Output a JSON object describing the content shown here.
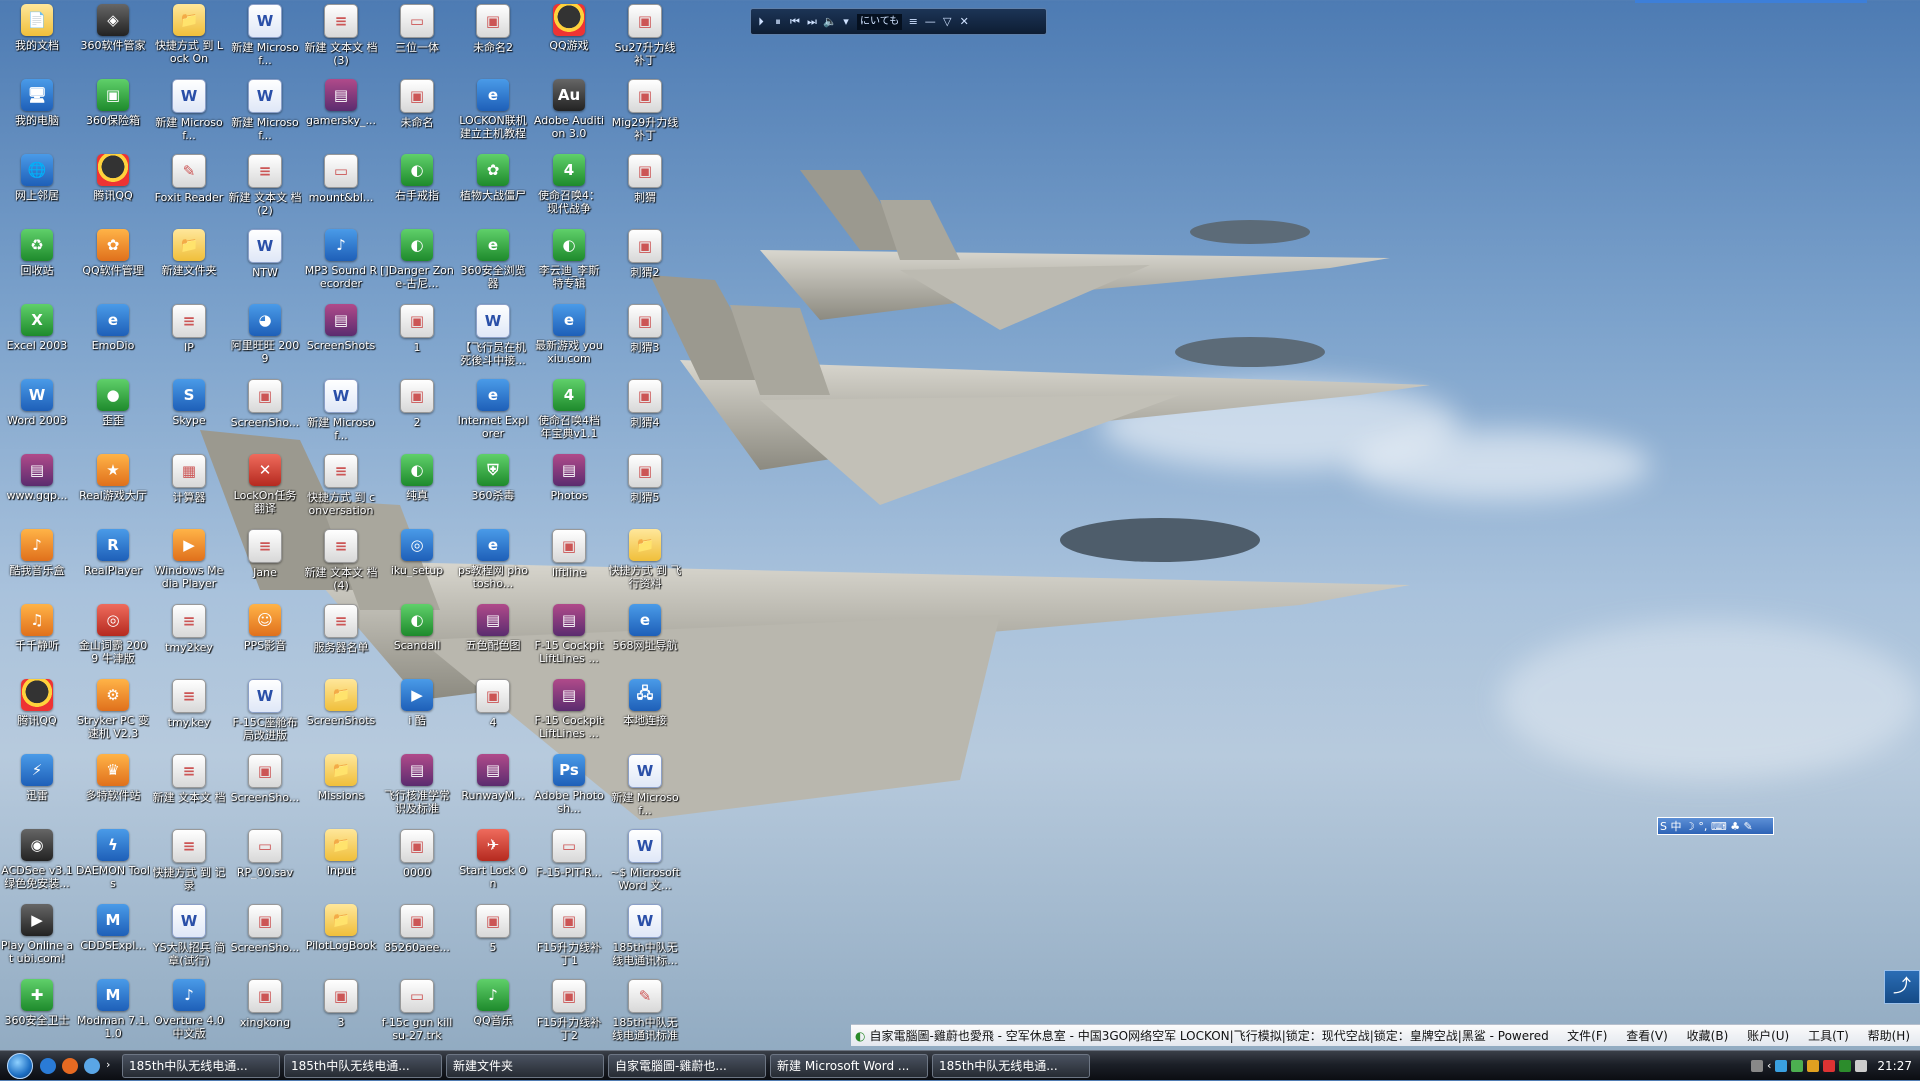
{
  "media_player": {
    "display_text": "にいても",
    "buttons": [
      "⏵",
      "⏸",
      "⏮",
      "⏭",
      "🔈",
      "▾",
      "≡",
      "—",
      "▽",
      "✕"
    ]
  },
  "ime_toolbar": {
    "label": "S 中 ☽ °, ⌨ ♣ ✎"
  },
  "widget_glyph": "⤴",
  "browser_strip": {
    "title": "自家電腦圖-雞蔚也愛飛 - 空军休息室 - 中国3GO网络空军 LOCKON|飞行模拟|锁定：现代空战|锁定：皇牌空战|黑鲨 - Powered ...",
    "menu": [
      "文件(F)",
      "查看(V)",
      "收藏(B)",
      "账户(U)",
      "工具(T)",
      "帮助(H)"
    ]
  },
  "taskbar": {
    "buttons": [
      "185th中队无线电通...",
      "185th中队无线电通...",
      "新建文件夹",
      "自家電腦圖-雞蔚也...",
      "新建 Microsoft Word ...",
      "185th中队无线电通..."
    ],
    "clock": "21:27"
  },
  "icons": [
    {
      "label": "我的文档",
      "g": "g-folder",
      "s": "📄"
    },
    {
      "label": "我的电脑",
      "g": "g-blue",
      "s": "🖥"
    },
    {
      "label": "网上邻居",
      "g": "g-blue",
      "s": "🌐"
    },
    {
      "label": "回收站",
      "g": "g-green",
      "s": "♻"
    },
    {
      "label": "Excel 2003",
      "g": "g-green",
      "s": "X"
    },
    {
      "label": "Word 2003",
      "g": "g-blue",
      "s": "W"
    },
    {
      "label": "www.gqp...",
      "g": "g-rar",
      "s": "▤"
    },
    {
      "label": "酷我音乐盒",
      "g": "g-orange",
      "s": "♪"
    },
    {
      "label": "千千静听",
      "g": "g-orange",
      "s": "♫"
    },
    {
      "label": "腾讯QQ",
      "g": "g-qq",
      "s": ""
    },
    {
      "label": "迅雷",
      "g": "g-blue",
      "s": "⚡"
    },
    {
      "label": "ACDSee v3.1 绿色免安装...",
      "g": "g-dark",
      "s": "◉"
    },
    {
      "label": "Play Online at ubi.com!",
      "g": "g-dark",
      "s": "▶"
    },
    {
      "label": "360安全卫士",
      "g": "g-green",
      "s": "✚"
    },
    {
      "label": "360软件管家",
      "g": "g-dark",
      "s": "◈"
    },
    {
      "label": "360保险箱",
      "g": "g-green",
      "s": "▣"
    },
    {
      "label": "腾讯QQ",
      "g": "g-qq",
      "s": ""
    },
    {
      "label": "QQ软件管理",
      "g": "g-orange",
      "s": "✿"
    },
    {
      "label": "EmoDio",
      "g": "g-blue",
      "s": "e"
    },
    {
      "label": "歪歪",
      "g": "g-green",
      "s": "●"
    },
    {
      "label": "Real游戏大厅",
      "g": "g-orange",
      "s": "★"
    },
    {
      "label": "RealPlayer",
      "g": "g-blue",
      "s": "R"
    },
    {
      "label": "金山词霸 2009 牛津版",
      "g": "g-red",
      "s": "◎"
    },
    {
      "label": "Stryker PC 变 速机 V2.3",
      "g": "g-orange",
      "s": "⚙"
    },
    {
      "label": "多特软件站",
      "g": "g-orange",
      "s": "♛"
    },
    {
      "label": "DAEMON Tools",
      "g": "g-blue",
      "s": "ϟ"
    },
    {
      "label": "CDDSExpl...",
      "g": "g-blue",
      "s": "M"
    },
    {
      "label": "Modman 7.1.1.0",
      "g": "g-blue",
      "s": "M"
    },
    {
      "label": "快捷方式 到 Lock On",
      "g": "g-folder",
      "s": "📁"
    },
    {
      "label": "新建 Microsof...",
      "g": "g-word",
      "s": "W"
    },
    {
      "label": "Foxit Reader",
      "g": "g-doc",
      "s": "✎"
    },
    {
      "label": "新建文件夹",
      "g": "g-folder",
      "s": "📁"
    },
    {
      "label": "IP",
      "g": "g-doc",
      "s": "≡"
    },
    {
      "label": "Skype",
      "g": "g-blue",
      "s": "S"
    },
    {
      "label": "计算器",
      "g": "g-doc",
      "s": "▦"
    },
    {
      "label": "Windows Media Player",
      "g": "g-orange",
      "s": "▶"
    },
    {
      "label": "tmy2key",
      "g": "g-doc",
      "s": "≡"
    },
    {
      "label": "tmy.key",
      "g": "g-doc",
      "s": "≡"
    },
    {
      "label": "新建 文本文 档",
      "g": "g-doc",
      "s": "≡"
    },
    {
      "label": "快捷方式 到 记录",
      "g": "g-doc",
      "s": "≡"
    },
    {
      "label": "YS大队招兵 简章(试行)",
      "g": "g-word",
      "s": "W"
    },
    {
      "label": "Overture 4.0 中文版",
      "g": "g-blue",
      "s": "♪"
    },
    {
      "label": "新建 Microsof...",
      "g": "g-word",
      "s": "W"
    },
    {
      "label": "新建 Microsof...",
      "g": "g-word",
      "s": "W"
    },
    {
      "label": "新建 文本文 档 (2)",
      "g": "g-doc",
      "s": "≡"
    },
    {
      "label": "NTW",
      "g": "g-word",
      "s": "W"
    },
    {
      "label": "阿里旺旺 2009",
      "g": "g-blue",
      "s": "◕"
    },
    {
      "label": "ScreenSho...",
      "g": "g-doc",
      "s": "▣"
    },
    {
      "label": "LockOn任务 翻译",
      "g": "g-red",
      "s": "✕"
    },
    {
      "label": "Jane",
      "g": "g-doc",
      "s": "≡"
    },
    {
      "label": "PPS影音",
      "g": "g-orange",
      "s": "☺"
    },
    {
      "label": "F-15C座舱布 局改进版",
      "g": "g-word",
      "s": "W"
    },
    {
      "label": "ScreenSho...",
      "g": "g-doc",
      "s": "▣"
    },
    {
      "label": "RP_00.sav",
      "g": "g-doc",
      "s": "▭"
    },
    {
      "label": "ScreenSho...",
      "g": "g-doc",
      "s": "▣"
    },
    {
      "label": "xingkong",
      "g": "g-doc",
      "s": "▣"
    },
    {
      "label": "新建 文本文 档 (3)",
      "g": "g-doc",
      "s": "≡"
    },
    {
      "label": "gamersky_...",
      "g": "g-rar",
      "s": "▤"
    },
    {
      "label": "mount&bl...",
      "g": "g-doc",
      "s": "▭"
    },
    {
      "label": "MP3 Sound Recorder",
      "g": "g-blue",
      "s": "♪"
    },
    {
      "label": "ScreenShots",
      "g": "g-rar",
      "s": "▤"
    },
    {
      "label": "新建 Microsof...",
      "g": "g-word",
      "s": "W"
    },
    {
      "label": "快捷方式 到 conversation",
      "g": "g-doc",
      "s": "≡"
    },
    {
      "label": "新建 文本文 档 (4)",
      "g": "g-doc",
      "s": "≡"
    },
    {
      "label": "服务器名单",
      "g": "g-doc",
      "s": "≡"
    },
    {
      "label": "ScreenShots",
      "g": "g-folder",
      "s": "📁"
    },
    {
      "label": "Missions",
      "g": "g-folder",
      "s": "📁"
    },
    {
      "label": "Input",
      "g": "g-folder",
      "s": "📁"
    },
    {
      "label": "PilotLogBook",
      "g": "g-folder",
      "s": "📁"
    },
    {
      "label": "3",
      "g": "g-doc",
      "s": "▣"
    },
    {
      "label": "三位一体",
      "g": "g-doc",
      "s": "▭"
    },
    {
      "label": "未命名",
      "g": "g-doc",
      "s": "▣"
    },
    {
      "label": "右手戒指",
      "g": "g-green",
      "s": "◐"
    },
    {
      "label": "[]Danger Zone-古尼...",
      "g": "g-green",
      "s": "◐"
    },
    {
      "label": "1",
      "g": "g-doc",
      "s": "▣"
    },
    {
      "label": "2",
      "g": "g-doc",
      "s": "▣"
    },
    {
      "label": "纯真",
      "g": "g-green",
      "s": "◐"
    },
    {
      "label": "iku_setup",
      "g": "g-blue",
      "s": "◎"
    },
    {
      "label": "Scandall",
      "g": "g-green",
      "s": "◐"
    },
    {
      "label": "i 酷",
      "g": "g-blue",
      "s": "▶"
    },
    {
      "label": "飞行核准学常 识及标准",
      "g": "g-rar",
      "s": "▤"
    },
    {
      "label": "0000",
      "g": "g-doc",
      "s": "▣"
    },
    {
      "label": "85260aee...",
      "g": "g-doc",
      "s": "▣"
    },
    {
      "label": "f-15c gun kill su-27.trk",
      "g": "g-doc",
      "s": "▭"
    },
    {
      "label": "未命名2",
      "g": "g-doc",
      "s": "▣"
    },
    {
      "label": "LOCKON联机 建立主机教程",
      "g": "g-blue",
      "s": "e"
    },
    {
      "label": "植物大战僵尸",
      "g": "g-green",
      "s": "✿"
    },
    {
      "label": "360安全浏览 器",
      "g": "g-green",
      "s": "e"
    },
    {
      "label": "【飞行员在机 死後斗中接...",
      "g": "g-word",
      "s": "W"
    },
    {
      "label": "Internet Explorer",
      "g": "g-blue",
      "s": "e"
    },
    {
      "label": "360杀毒",
      "g": "g-green",
      "s": "⛨"
    },
    {
      "label": "ps教程网 photosho...",
      "g": "g-blue",
      "s": "e"
    },
    {
      "label": "五色配色图",
      "g": "g-rar",
      "s": "▤"
    },
    {
      "label": "4",
      "g": "g-doc",
      "s": "▣"
    },
    {
      "label": "RunwayM...",
      "g": "g-rar",
      "s": "▤"
    },
    {
      "label": "Start Lock On",
      "g": "g-red",
      "s": "✈"
    },
    {
      "label": "5",
      "g": "g-doc",
      "s": "▣"
    },
    {
      "label": "QQ音乐",
      "g": "g-green",
      "s": "♪"
    },
    {
      "label": "QQ游戏",
      "g": "g-qq",
      "s": ""
    },
    {
      "label": "Adobe Audition 3.0",
      "g": "g-dark",
      "s": "Au"
    },
    {
      "label": "使命召唤4： 现代战争",
      "g": "g-green",
      "s": "4"
    },
    {
      "label": "李云迪_李斯 特专辑",
      "g": "g-green",
      "s": "◐"
    },
    {
      "label": "最新游戏 youxiu.com",
      "g": "g-blue",
      "s": "e"
    },
    {
      "label": "使命召唤4档 年宝典v1.1",
      "g": "g-green",
      "s": "4"
    },
    {
      "label": "Photos",
      "g": "g-rar",
      "s": "▤"
    },
    {
      "label": "liftline",
      "g": "g-doc",
      "s": "▣"
    },
    {
      "label": "F-15 Cockpit LiftLines ...",
      "g": "g-rar",
      "s": "▤"
    },
    {
      "label": "F-15 Cockpit LiftLines ...",
      "g": "g-rar",
      "s": "▤"
    },
    {
      "label": "Adobe Photosh...",
      "g": "g-blue",
      "s": "Ps"
    },
    {
      "label": "F-15-PIT-R...",
      "g": "g-doc",
      "s": "▭"
    },
    {
      "label": "F15升力线补 丁1",
      "g": "g-doc",
      "s": "▣"
    },
    {
      "label": "F15升力线补 丁2",
      "g": "g-doc",
      "s": "▣"
    },
    {
      "label": "Su27升力线 补丁",
      "g": "g-doc",
      "s": "▣"
    },
    {
      "label": "Mig29升力线 补丁",
      "g": "g-doc",
      "s": "▣"
    },
    {
      "label": "刺猬",
      "g": "g-doc",
      "s": "▣"
    },
    {
      "label": "刺猬2",
      "g": "g-doc",
      "s": "▣"
    },
    {
      "label": "刺猬3",
      "g": "g-doc",
      "s": "▣"
    },
    {
      "label": "刺猬4",
      "g": "g-doc",
      "s": "▣"
    },
    {
      "label": "刺猬5",
      "g": "g-doc",
      "s": "▣"
    },
    {
      "label": "快捷方式 到 飞行资料",
      "g": "g-folder",
      "s": "📁"
    },
    {
      "label": "568网址导航",
      "g": "g-blue",
      "s": "e"
    },
    {
      "label": "本地连接",
      "g": "g-blue",
      "s": "🖧"
    },
    {
      "label": "新建 Microsof...",
      "g": "g-word",
      "s": "W"
    },
    {
      "label": "~$ Microsoft Word 文...",
      "g": "g-word",
      "s": "W"
    },
    {
      "label": "185th中队无 线电通讯标...",
      "g": "g-word",
      "s": "W"
    },
    {
      "label": "185th中队无 线电通讯标准 手册",
      "g": "g-doc",
      "s": "✎"
    }
  ]
}
